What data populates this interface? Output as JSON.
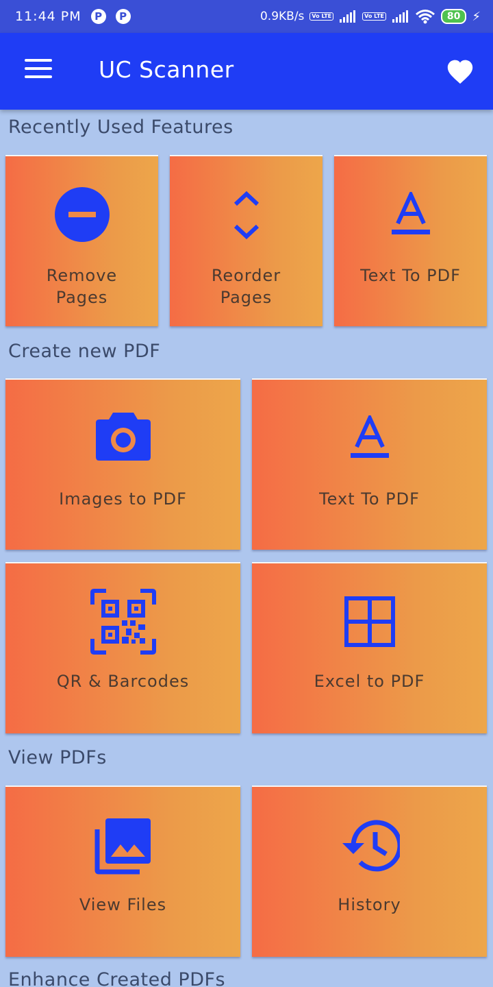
{
  "status_bar": {
    "time": "11:44 PM",
    "notification_icons": [
      "P",
      "P"
    ],
    "net_speed": "0.9KB/s",
    "volte_label": "Vo LTE",
    "battery": "80"
  },
  "toolbar": {
    "title": "UC Scanner",
    "menu_icon": "hamburger-menu-icon",
    "favorite_icon": "heart-icon"
  },
  "sections": {
    "recent": {
      "title": "Recently Used Features",
      "items": [
        {
          "label": "Remove Pages",
          "icon": "remove-circle-icon"
        },
        {
          "label": "Reorder Pages",
          "icon": "reorder-chevrons-icon"
        },
        {
          "label": "Text To PDF",
          "icon": "text-format-icon"
        }
      ]
    },
    "create": {
      "title": "Create new PDF",
      "items": [
        {
          "label": "Images to PDF",
          "icon": "camera-icon"
        },
        {
          "label": "Text To PDF",
          "icon": "text-format-icon"
        },
        {
          "label": "QR & Barcodes",
          "icon": "qr-code-scan-icon"
        },
        {
          "label": "Excel to PDF",
          "icon": "grid-table-icon"
        }
      ]
    },
    "view": {
      "title": "View PDFs",
      "items": [
        {
          "label": "View Files",
          "icon": "image-library-icon"
        },
        {
          "label": "History",
          "icon": "history-clock-icon"
        }
      ]
    },
    "enhance": {
      "title": "Enhance Created PDFs"
    }
  },
  "colors": {
    "status_bar": "#3a4fd6",
    "toolbar": "#1f3df5",
    "background": "#aec6ee",
    "card_gradient_start": "#f56c45",
    "card_gradient_end": "#eda64a",
    "icon": "#1f3df5",
    "label_text": "#4b3a30"
  }
}
